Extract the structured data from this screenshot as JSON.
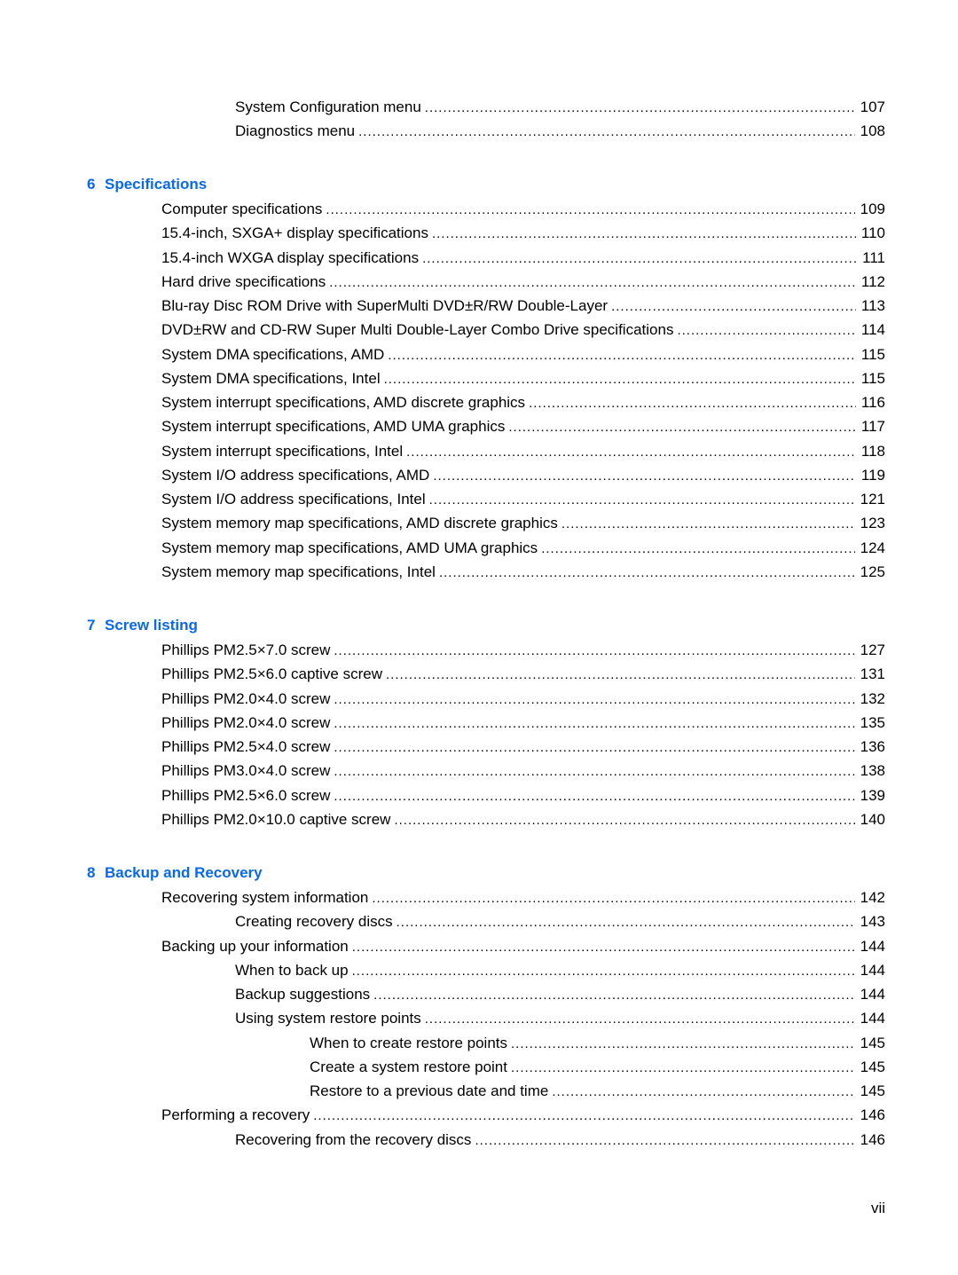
{
  "accent_color": "#0a68f0",
  "leading_entries": [
    {
      "title": "System Configuration menu",
      "page": "107",
      "level": 2
    },
    {
      "title": "Diagnostics menu",
      "page": "108",
      "level": 2
    }
  ],
  "chapters": [
    {
      "number": "6",
      "title": "Specifications",
      "entries": [
        {
          "title": "Computer specifications",
          "page": "109",
          "level": 1
        },
        {
          "title": "15.4-inch, SXGA+ display specifications",
          "page": "110",
          "level": 1
        },
        {
          "title": "15.4-inch WXGA display specifications",
          "page": "111",
          "level": 1
        },
        {
          "title": "Hard drive specifications",
          "page": "112",
          "level": 1
        },
        {
          "title": "Blu-ray Disc ROM Drive with SuperMulti DVD±R/RW Double-Layer",
          "page": "113",
          "level": 1
        },
        {
          "title": "DVD±RW and CD-RW Super Multi Double-Layer Combo Drive specifications",
          "page": "114",
          "level": 1
        },
        {
          "title": "System DMA specifications, AMD",
          "page": "115",
          "level": 1
        },
        {
          "title": "System DMA specifications, Intel",
          "page": "115",
          "level": 1
        },
        {
          "title": "System interrupt specifications, AMD discrete graphics",
          "page": "116",
          "level": 1
        },
        {
          "title": "System interrupt specifications, AMD UMA graphics",
          "page": "117",
          "level": 1
        },
        {
          "title": "System interrupt specifications, Intel",
          "page": "118",
          "level": 1
        },
        {
          "title": "System I/O address specifications, AMD",
          "page": "119",
          "level": 1
        },
        {
          "title": "System I/O address specifications, Intel",
          "page": "121",
          "level": 1
        },
        {
          "title": "System memory map specifications, AMD discrete graphics",
          "page": "123",
          "level": 1
        },
        {
          "title": "System memory map specifications, AMD UMA graphics",
          "page": "124",
          "level": 1
        },
        {
          "title": "System memory map specifications, Intel",
          "page": "125",
          "level": 1
        }
      ]
    },
    {
      "number": "7",
      "title": "Screw listing",
      "entries": [
        {
          "title": "Phillips PM2.5×7.0 screw",
          "page": "127",
          "level": 1
        },
        {
          "title": "Phillips PM2.5×6.0 captive screw",
          "page": "131",
          "level": 1
        },
        {
          "title": "Phillips PM2.0×4.0 screw",
          "page": "132",
          "level": 1
        },
        {
          "title": "Phillips PM2.0×4.0 screw",
          "page": "135",
          "level": 1
        },
        {
          "title": "Phillips PM2.5×4.0 screw",
          "page": "136",
          "level": 1
        },
        {
          "title": "Phillips PM3.0×4.0 screw",
          "page": "138",
          "level": 1
        },
        {
          "title": "Phillips PM2.5×6.0 screw",
          "page": "139",
          "level": 1
        },
        {
          "title": "Phillips PM2.0×10.0 captive screw",
          "page": "140",
          "level": 1
        }
      ]
    },
    {
      "number": "8",
      "title": "Backup and Recovery",
      "entries": [
        {
          "title": "Recovering system information",
          "page": "142",
          "level": 1
        },
        {
          "title": "Creating recovery discs",
          "page": "143",
          "level": 2
        },
        {
          "title": "Backing up your information",
          "page": "144",
          "level": 1
        },
        {
          "title": "When to back up",
          "page": "144",
          "level": 2
        },
        {
          "title": "Backup suggestions",
          "page": "144",
          "level": 2
        },
        {
          "title": "Using system restore points",
          "page": "144",
          "level": 2
        },
        {
          "title": "When to create restore points",
          "page": "145",
          "level": 3
        },
        {
          "title": "Create a system restore point",
          "page": "145",
          "level": 3
        },
        {
          "title": "Restore to a previous date and time",
          "page": "145",
          "level": 3
        },
        {
          "title": "Performing a recovery",
          "page": "146",
          "level": 1
        },
        {
          "title": "Recovering from the recovery discs",
          "page": "146",
          "level": 2
        }
      ]
    }
  ],
  "footer": {
    "page_number": "vii"
  }
}
